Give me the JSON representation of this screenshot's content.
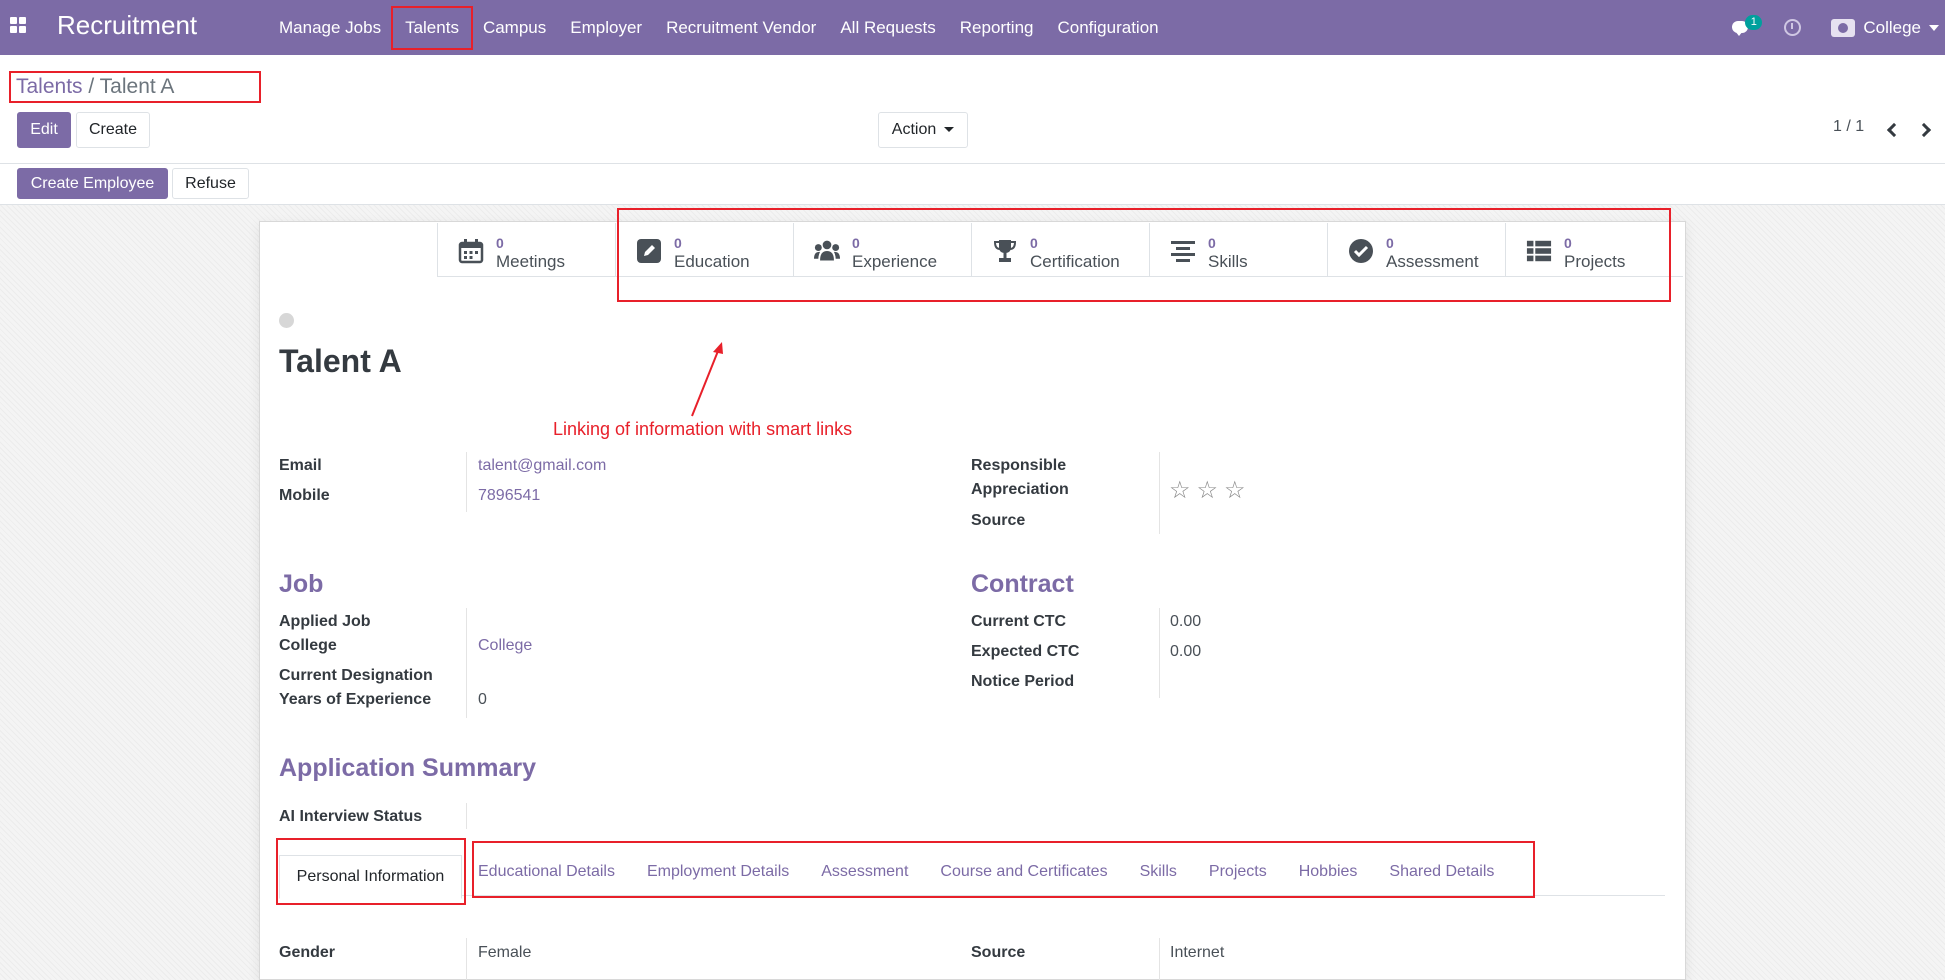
{
  "app": {
    "title": "Recruitment",
    "menu": [
      "Manage Jobs",
      "Talents",
      "Campus",
      "Employer",
      "Recruitment Vendor",
      "All Requests",
      "Reporting",
      "Configuration"
    ],
    "chat_count": "1",
    "company": "College"
  },
  "control": {
    "breadcrumb_parent": "Talents",
    "breadcrumb_sep": " / ",
    "breadcrumb_current": "Talent A",
    "edit": "Edit",
    "create": "Create",
    "action": "Action",
    "pager": "1 / 1"
  },
  "statusbar": {
    "create_employee": "Create Employee",
    "refuse": "Refuse"
  },
  "smart_buttons": [
    {
      "count": "0",
      "label": "Meetings",
      "icon": "calendar-icon"
    },
    {
      "count": "0",
      "label": "Education",
      "icon": "edit-icon"
    },
    {
      "count": "0",
      "label": "Experience",
      "icon": "users-icon"
    },
    {
      "count": "0",
      "label": "Certification",
      "icon": "trophy-icon"
    },
    {
      "count": "0",
      "label": "Skills",
      "icon": "align-center-icon"
    },
    {
      "count": "0",
      "label": "Assessment",
      "icon": "check-circle-icon"
    },
    {
      "count": "0",
      "label": "Projects",
      "icon": "list-icon"
    }
  ],
  "record": {
    "name": "Talent A",
    "annotation": "Linking of information with smart links"
  },
  "fields": {
    "email_label": "Email",
    "email": "talent@gmail.com",
    "mobile_label": "Mobile",
    "mobile": "7896541",
    "responsible_label": "Responsible",
    "appreciation_label": "Appreciation",
    "source_label": "Source",
    "appreciation_stars": 0
  },
  "job": {
    "title": "Job",
    "applied_job_label": "Applied Job",
    "college_label": "College",
    "college": "College",
    "current_designation_label": "Current Designation",
    "years_exp_label": "Years of Experience",
    "years_exp": "0"
  },
  "contract": {
    "title": "Contract",
    "current_ctc_label": "Current CTC",
    "current_ctc": "0.00",
    "expected_ctc_label": "Expected CTC",
    "expected_ctc": "0.00",
    "notice_label": "Notice Period"
  },
  "summary": {
    "title": "Application Summary",
    "ai_status_label": "AI Interview Status"
  },
  "tabs": [
    "Personal Information",
    "Educational Details",
    "Employment Details",
    "Assessment",
    "Course and Certificates",
    "Skills",
    "Projects",
    "Hobbies",
    "Shared Details"
  ],
  "personal": {
    "gender_label": "Gender",
    "gender": "Female",
    "source_label": "Source",
    "source": "Internet"
  },
  "colors": {
    "brand": "#7c6ba6",
    "highlight": "#e8202a"
  }
}
